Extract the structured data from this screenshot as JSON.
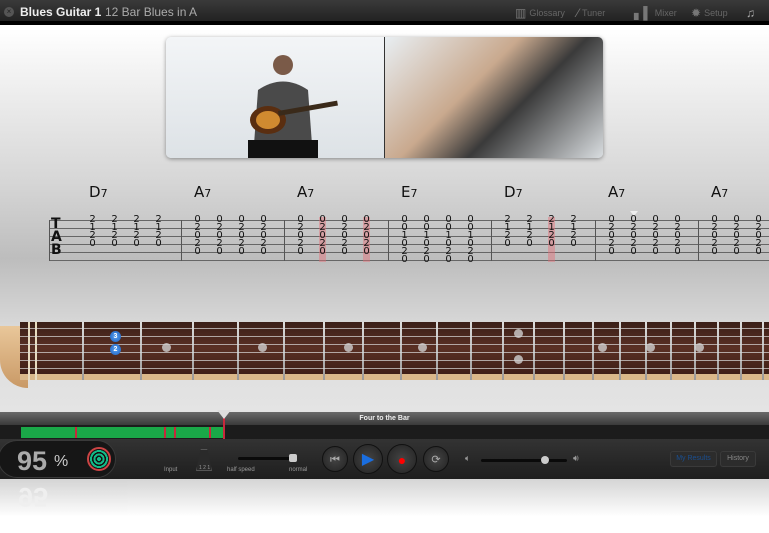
{
  "titlebar": {
    "lesson": "Blues Guitar 1",
    "subtitle": "12 Bar Blues in A",
    "items": [
      {
        "label": "Glossary",
        "icon": "book-icon"
      },
      {
        "label": "Tuner",
        "icon": "tuning-fork-icon"
      },
      {
        "label": "Mixer",
        "icon": "mixer-icon"
      },
      {
        "label": "Setup",
        "icon": "gear-icon"
      },
      {
        "label": "",
        "icon": "music-note-icon"
      }
    ]
  },
  "tab": {
    "measures": [
      {
        "chord": "D",
        "ext": "7",
        "cols": [
          [
            "2",
            "1",
            "2",
            "0",
            "",
            ""
          ],
          [
            "2",
            "1",
            "2",
            "0",
            "",
            ""
          ],
          [
            "2",
            "1",
            "2",
            "0",
            "",
            ""
          ],
          [
            "2",
            "1",
            "2",
            "0",
            "",
            ""
          ]
        ]
      },
      {
        "chord": "A",
        "ext": "7",
        "cols": [
          [
            "0",
            "2",
            "0",
            "2",
            "0",
            ""
          ],
          [
            "0",
            "2",
            "0",
            "2",
            "0",
            ""
          ],
          [
            "0",
            "2",
            "0",
            "2",
            "0",
            ""
          ],
          [
            "0",
            "2",
            "0",
            "2",
            "0",
            ""
          ]
        ]
      },
      {
        "chord": "A",
        "ext": "7",
        "cols": [
          [
            "0",
            "2",
            "0",
            "2",
            "0",
            ""
          ],
          [
            "0",
            "2",
            "0",
            "2",
            "0",
            ""
          ],
          [
            "0",
            "2",
            "0",
            "2",
            "0",
            ""
          ],
          [
            "0",
            "2",
            "0",
            "2",
            "0",
            ""
          ]
        ],
        "highlight": [
          1,
          3
        ]
      },
      {
        "chord": "E",
        "ext": "7",
        "cols": [
          [
            "0",
            "0",
            "1",
            "0",
            "2",
            "0"
          ],
          [
            "0",
            "0",
            "1",
            "0",
            "2",
            "0"
          ],
          [
            "0",
            "0",
            "1",
            "0",
            "2",
            "0"
          ],
          [
            "0",
            "0",
            "1",
            "0",
            "2",
            "0"
          ]
        ]
      },
      {
        "chord": "D",
        "ext": "7",
        "cols": [
          [
            "2",
            "1",
            "2",
            "0",
            "",
            ""
          ],
          [
            "2",
            "1",
            "2",
            "0",
            "",
            ""
          ],
          [
            "2",
            "1",
            "2",
            "0",
            "",
            ""
          ],
          [
            "2",
            "1",
            "2",
            "0",
            "",
            ""
          ]
        ],
        "highlight": [
          2
        ]
      },
      {
        "chord": "A",
        "ext": "7",
        "cols": [
          [
            "0",
            "2",
            "0",
            "2",
            "0",
            ""
          ],
          [
            "0",
            "2",
            "0",
            "2",
            "0",
            ""
          ],
          [
            "0",
            "2",
            "0",
            "2",
            "0",
            ""
          ],
          [
            "0",
            "2",
            "0",
            "2",
            "0",
            ""
          ]
        ],
        "marker": 1
      },
      {
        "chord": "A",
        "ext": "7",
        "cols": [
          [
            "0",
            "2",
            "0",
            "2",
            "0",
            ""
          ],
          [
            "0",
            "2",
            "0",
            "2",
            "0",
            ""
          ],
          [
            "0",
            "2",
            "0",
            "2",
            "0",
            ""
          ]
        ]
      }
    ]
  },
  "fretboard": {
    "fingers": [
      {
        "label": "3"
      },
      {
        "label": "2"
      }
    ]
  },
  "progress": {
    "section": "Four to the Bar",
    "played_fraction": 0.26
  },
  "controls": {
    "score": "95",
    "score_unit": "%",
    "input_label": "Input",
    "metronome_label": "1 2 1",
    "half_speed": "half speed",
    "normal": "normal",
    "my_results": "My Results",
    "history": "History"
  },
  "colors": {
    "green": "#1aa848",
    "red": "#c8283c",
    "blue": "#1a6ee0"
  }
}
